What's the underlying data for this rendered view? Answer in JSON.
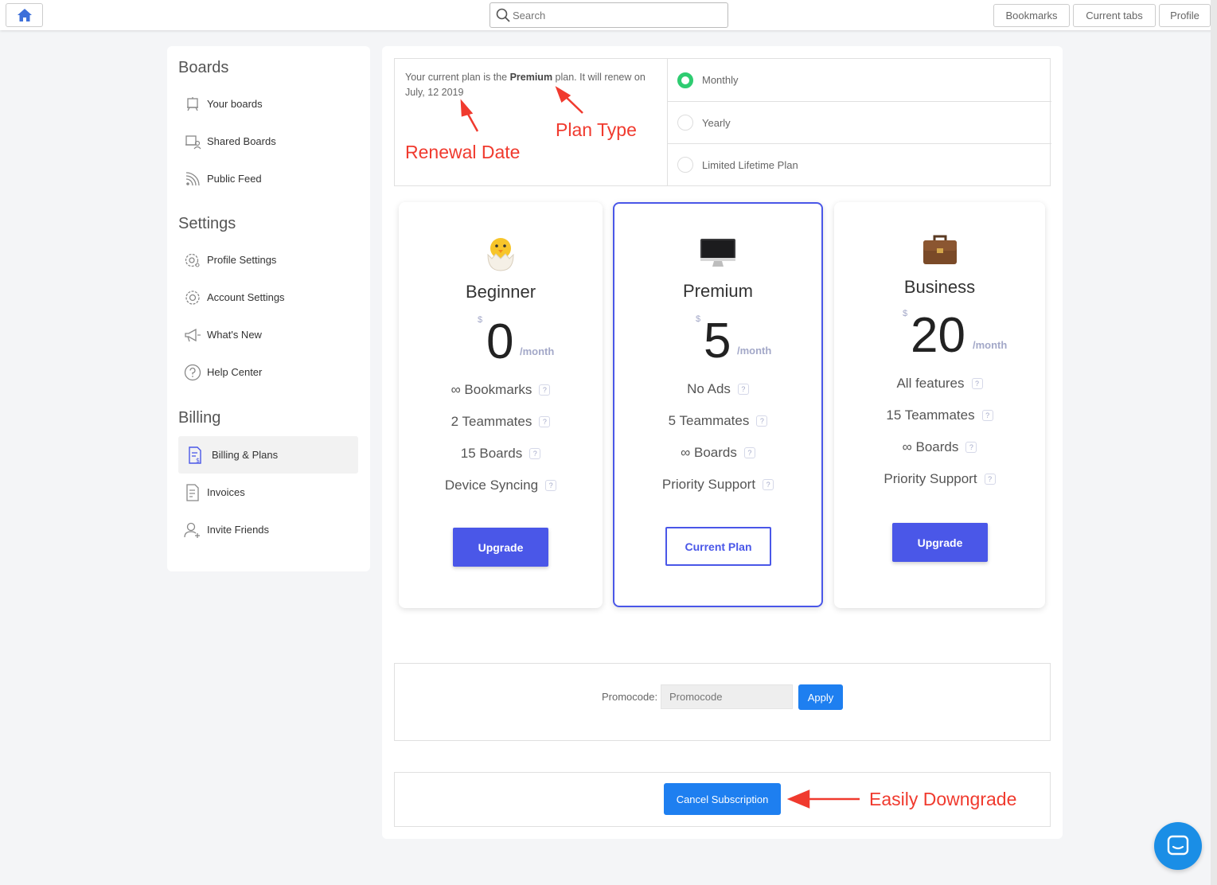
{
  "topbar": {
    "search_placeholder": "Search",
    "buttons": [
      "Bookmarks",
      "Current tabs",
      "Profile"
    ]
  },
  "sidebar": {
    "sections": [
      {
        "title": "Boards",
        "items": [
          {
            "label": "Your boards",
            "icon": "board-icon"
          },
          {
            "label": "Shared Boards",
            "icon": "shared-board-icon"
          },
          {
            "label": "Public Feed",
            "icon": "rss-icon"
          }
        ]
      },
      {
        "title": "Settings",
        "items": [
          {
            "label": "Profile Settings",
            "icon": "profile-gear-icon"
          },
          {
            "label": "Account Settings",
            "icon": "gear-icon"
          },
          {
            "label": "What's New",
            "icon": "megaphone-icon"
          },
          {
            "label": "Help Center",
            "icon": "help-icon"
          }
        ]
      },
      {
        "title": "Billing",
        "items": [
          {
            "label": "Billing & Plans",
            "icon": "billing-icon",
            "active": true
          },
          {
            "label": "Invoices",
            "icon": "invoice-icon"
          },
          {
            "label": "Invite Friends",
            "icon": "add-user-icon"
          }
        ]
      }
    ]
  },
  "plan_status": {
    "prefix": "Your current plan is the ",
    "plan": "Premium",
    "suffix": " plan. It will renew on July, 12 2019"
  },
  "billing_options": [
    {
      "label": "Monthly",
      "selected": true
    },
    {
      "label": "Yearly",
      "selected": false
    },
    {
      "label": "Limited Lifetime Plan",
      "selected": false
    }
  ],
  "plans": [
    {
      "name": "Beginner",
      "currency": "$",
      "price": "0",
      "period": "/month",
      "emoji": "🐣",
      "features": [
        "∞ Bookmarks",
        "2 Teammates",
        "15 Boards",
        "Device Syncing"
      ],
      "button": "Upgrade",
      "current": false
    },
    {
      "name": "Premium",
      "currency": "$",
      "price": "5",
      "period": "/month",
      "emoji": "🖥️",
      "features": [
        "No Ads",
        "5 Teammates",
        "∞ Boards",
        "Priority Support"
      ],
      "button": "Current Plan",
      "current": true
    },
    {
      "name": "Business",
      "currency": "$",
      "price": "20",
      "period": "/month",
      "emoji": "💼",
      "features": [
        "All features",
        "15 Teammates",
        "∞ Boards",
        "Priority Support"
      ],
      "button": "Upgrade",
      "current": false
    }
  ],
  "help_mark": "?",
  "promo": {
    "label": "Promocode:",
    "placeholder": "Promocode",
    "apply": "Apply"
  },
  "cancel": {
    "label": "Cancel Subscription"
  },
  "annotations": {
    "renewal_date": "Renewal Date",
    "plan_type": "Plan Type",
    "downgrade": "Easily Downgrade"
  },
  "colors": {
    "accent": "#4a57e8",
    "blue_button": "#1e7ff0",
    "annotation": "#f03a2e",
    "radio_on": "#2ecc71"
  }
}
